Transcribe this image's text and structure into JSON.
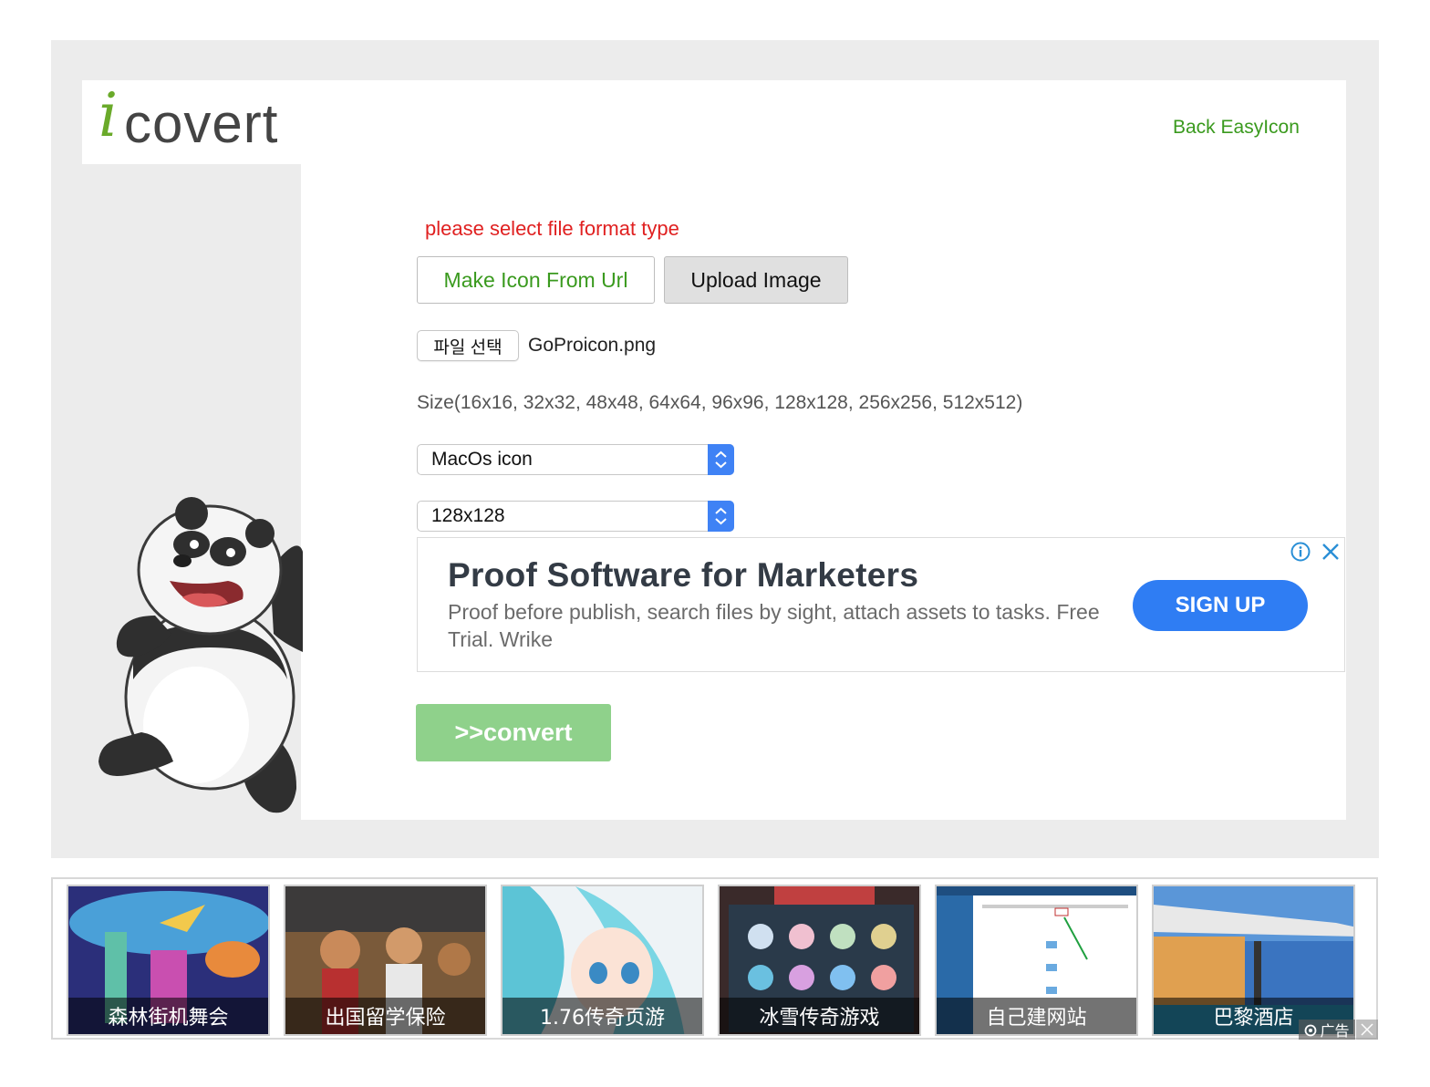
{
  "logo": {
    "mark": "i",
    "text": "covert"
  },
  "header": {
    "back_link": "Back EasyIcon"
  },
  "form": {
    "prompt": "please select file format type",
    "make_icon_button": "Make Icon From Url",
    "upload_button": "Upload Image",
    "file_button": "파일 선택",
    "file_name": "GoProicon.png",
    "size_info": "Size(16x16, 32x32, 48x48, 64x64, 96x96, 128x128, 256x256, 512x512)",
    "format_select": "MacOs icon",
    "size_select": "128x128",
    "convert_button": ">>convert"
  },
  "ad": {
    "title": "Proof Software for Marketers",
    "description": "Proof before publish, search files by sight, attach assets to tasks. Free Trial. Wrike",
    "cta": "SIGN UP"
  },
  "bottom_ads": {
    "items": [
      {
        "caption": "森林街机舞会"
      },
      {
        "caption": "出国留学保险"
      },
      {
        "caption": "1.76传奇页游"
      },
      {
        "caption": "冰雪传奇游戏"
      },
      {
        "caption": "自己建网站"
      },
      {
        "caption": "巴黎酒店"
      }
    ],
    "badge": "广告"
  },
  "colors": {
    "accent_green": "#3a9a1e",
    "prompt_red": "#e02020",
    "convert_green": "#8fd18b",
    "cta_blue": "#2f7df3",
    "select_blue": "#3f82f5"
  },
  "icons": [
    "info-icon",
    "close-icon",
    "chevron-updown-icon",
    "panda-mascot",
    "ad-choice-icon"
  ]
}
